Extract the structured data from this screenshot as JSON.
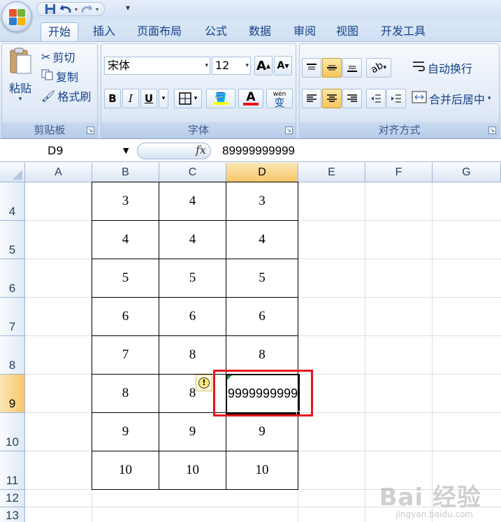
{
  "quick_access": {
    "save": "save-icon",
    "undo": "undo-icon",
    "redo": "redo-icon",
    "customize": "▾"
  },
  "tabs": [
    {
      "label": "开始",
      "active": true
    },
    {
      "label": "插入"
    },
    {
      "label": "页面布局"
    },
    {
      "label": "公式"
    },
    {
      "label": "数据"
    },
    {
      "label": "审阅"
    },
    {
      "label": "视图"
    },
    {
      "label": "开发工具"
    }
  ],
  "clipboard": {
    "paste": "粘贴",
    "cut": "剪切",
    "copy": "复制",
    "format_painter": "格式刷",
    "group": "剪贴板"
  },
  "font": {
    "name": "宋体",
    "size": "12",
    "bold": "B",
    "italic": "I",
    "underline": "U",
    "phonetic": "wén",
    "group": "字体"
  },
  "alignment": {
    "wrap_text": "自动换行",
    "merge_center": "合并后居中",
    "group": "对齐方式"
  },
  "formula_bar": {
    "name_box": "D9",
    "fx": "fx",
    "value": "89999999999"
  },
  "sheet": {
    "columns": [
      "A",
      "B",
      "C",
      "D",
      "E",
      "F",
      "G"
    ],
    "selected_column": "D",
    "rows": [
      "4",
      "5",
      "6",
      "7",
      "8",
      "9",
      "10",
      "11",
      "12",
      "13"
    ],
    "selected_row": "9",
    "table": [
      {
        "b": "3",
        "c": "4",
        "d": "3"
      },
      {
        "b": "4",
        "c": "4",
        "d": "4"
      },
      {
        "b": "5",
        "c": "5",
        "d": "5"
      },
      {
        "b": "6",
        "c": "6",
        "d": "6"
      },
      {
        "b": "7",
        "c": "8",
        "d": "8"
      },
      {
        "b": "8",
        "c": "8",
        "d": "9999999999"
      },
      {
        "b": "9",
        "c": "9",
        "d": "9"
      },
      {
        "b": "10",
        "c": "10",
        "d": "10"
      }
    ]
  },
  "colors": {
    "accent_selected": "#f7c66b",
    "highlight_box": "#e8131b",
    "font_color_bar": "#e8131b",
    "fill_color_bar": "#ffff00"
  },
  "watermark": {
    "text": "Bai 经验",
    "sub": "jingyan.baidu.com"
  }
}
